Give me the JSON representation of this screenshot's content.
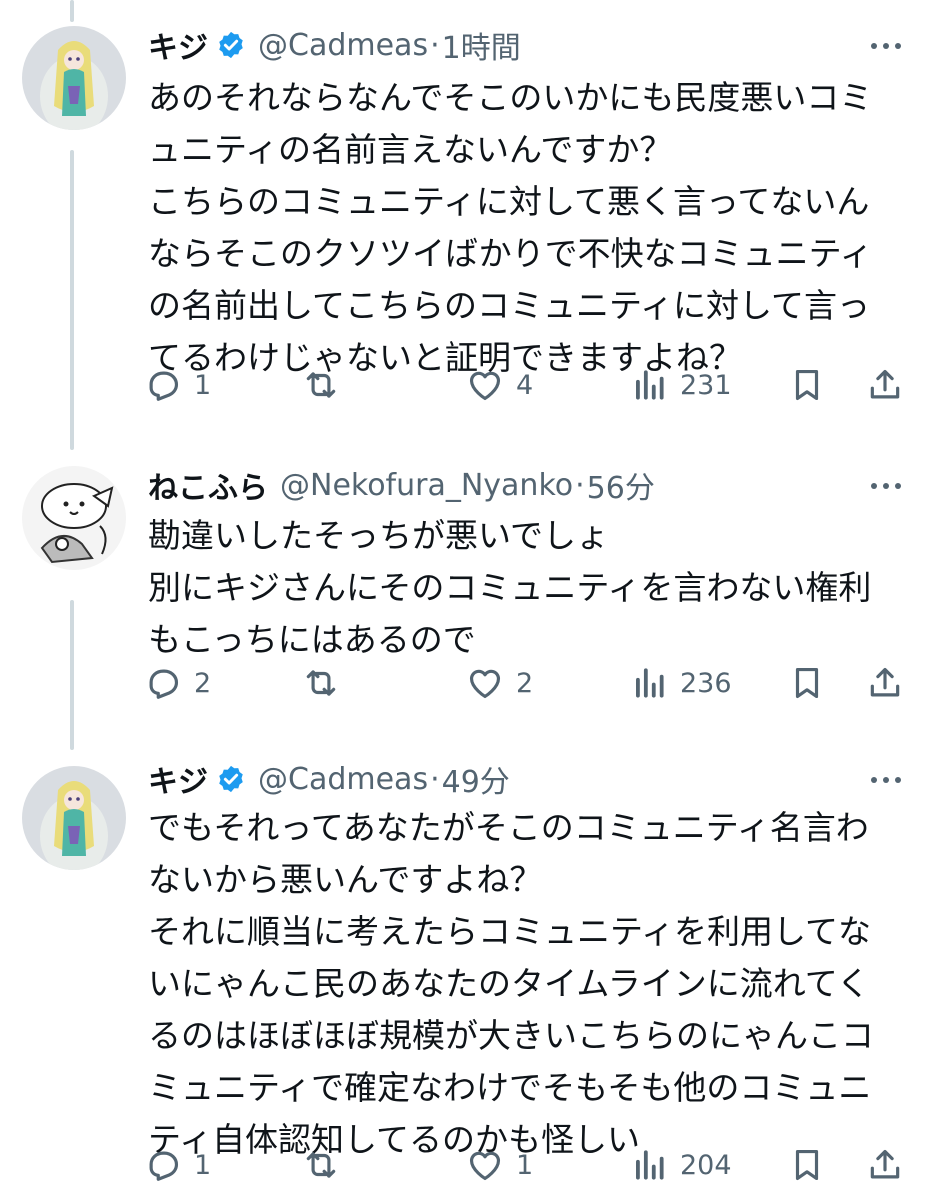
{
  "tweets": [
    {
      "name": "キジ",
      "verified": true,
      "handle": "@Cadmeas",
      "time": "1時間",
      "lines": [
        "あのそれならなんでそこのいかにも民度悪いコミ",
        "ュニティの名前言えないんですか？",
        "こちらのコミュニティに対して悪く言ってないん",
        "ならそこのクソツイばかりで不快なコミュニティ",
        "の名前出してこちらのコミュニティに対して言っ",
        "てるわけじゃないと証明できますよね？"
      ],
      "replies": "1",
      "retweets": "",
      "likes": "4",
      "views": "231"
    },
    {
      "name": "ねこふら",
      "verified": false,
      "handle": "@Nekofura_Nyanko",
      "time": "56分",
      "lines": [
        "勘違いしたそっちが悪いでしょ",
        "別にキジさんにそのコミュニティを言わない権利",
        "もこっちにはあるので"
      ],
      "replies": "2",
      "retweets": "",
      "likes": "2",
      "views": "236"
    },
    {
      "name": "キジ",
      "verified": true,
      "handle": "@Cadmeas",
      "time": "49分",
      "lines": [
        "でもそれってあなたがそこのコミュニティ名言わ",
        "ないから悪いんですよね？",
        "それに順当に考えたらコミュニティを利用してな",
        "いにゃんこ民のあなたのタイムラインに流れてく",
        "るのはほぼほぼ規模が大きいこちらのにゃんこコ",
        "ミュニティで確定なわけでそもそも他のコミュニ",
        "ティ自体認知してるのかも怪しい"
      ],
      "replies": "1",
      "retweets": "",
      "likes": "1",
      "views": "204"
    }
  ],
  "separator": "·",
  "colors": {
    "text": "#0f1419",
    "secondary": "#536471",
    "verified": "#1d9bf0",
    "thread_line": "#cfd9de"
  },
  "icons": [
    "verified-badge-icon",
    "more-icon",
    "reply-icon",
    "retweet-icon",
    "like-icon",
    "views-icon",
    "bookmark-icon",
    "share-icon"
  ]
}
